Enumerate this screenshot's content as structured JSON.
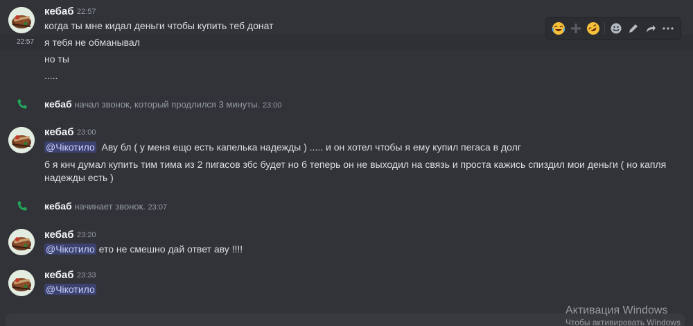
{
  "colors": {
    "background": "#313338",
    "mention_bg": "#3c4270",
    "mention_text": "#c9cdfb",
    "call_icon": "#23a55a",
    "timestamp": "#949ba4"
  },
  "toolbar": {
    "icons": [
      "joy-emoji-icon",
      "plus-icon",
      "rofl-emoji-icon",
      "add-reaction-icon",
      "edit-icon",
      "forward-icon",
      "more-icon"
    ]
  },
  "messages": [
    {
      "author": "кебаб",
      "time": "22:57",
      "lines": [
        "когда ты мне кидал деньги чтобы купить теб донат",
        "я тебя не обманывал",
        "но ты",
        "....."
      ],
      "hover_time": "22:57"
    },
    {
      "author": "кебаб",
      "time": "23:00",
      "mention": "@Чікотило",
      "line1_text": "Аву бл ( у меня ещо есть капелька надежды ) ..... и он хотел чтобы я ему купил пегаса в долг",
      "line2": "б я кнч думал купить тим тима из 2 пигасов збс будет но б теперь он не выходил на связь и проста кажись спиздил мои деньги ( но капля",
      "line3": "надежды есть )"
    },
    {
      "author": "кебаб",
      "time": "23:20",
      "mention": "@Чікотило",
      "text": "ето не смешно дай ответ аву !!!!"
    },
    {
      "author": "кебаб",
      "time": "23:33",
      "mention": "@Чікотило"
    }
  ],
  "system": [
    {
      "author": "кебаб",
      "text": "начал звонок, который продлился 3 минуты.",
      "time": "23:00"
    },
    {
      "author": "кебаб",
      "text": "начинает звонок.",
      "time": "23:07"
    }
  ],
  "watermark": {
    "title": "Активация Windows",
    "subtitle": "Чтобы активировать Windows"
  }
}
